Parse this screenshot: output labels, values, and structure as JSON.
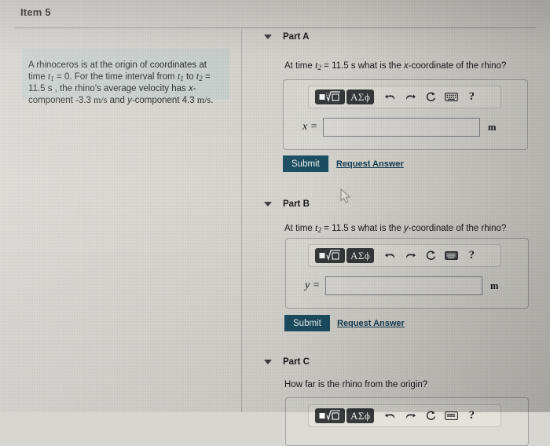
{
  "header": {
    "item_title": "Item 5"
  },
  "problem": {
    "line1_a": "A rhinoceros is at the origin of coordinates at time ",
    "t1": "t",
    "t1_sub": "1",
    "line2_a": " = 0. For the time interval from ",
    "t1b": "t",
    "t1b_sub": "1",
    "line2_b": " to ",
    "t2": "t",
    "t2_sub": "2",
    "line2_c": " = 11.5 s , the rhino's average velocity has ",
    "xvar": "x",
    "line3_a": "-component -3.3 ",
    "unit_ms": "m/s",
    "line3_b": " and ",
    "yvar": "y",
    "line3_c": "-component 4.3 ",
    "unit_ms2": "m/s",
    "period": "."
  },
  "toolbar": {
    "template_button": "template-button",
    "greek_button": "ΑΣϕ",
    "undo": "undo-arrow",
    "redo": "redo-arrow",
    "reset": "reset-circular-arrow",
    "keyboard": "keyboard-icon",
    "help": "?"
  },
  "parts": [
    {
      "id": "part-a",
      "label": "Part A",
      "question_pre": "At time ",
      "question_var": "t",
      "question_sub": "2",
      "question_mid": " = 11.5 s what is the ",
      "question_coord": "x",
      "question_post": "-coordinate of the rhino?",
      "var_label": "x =",
      "input_value": "",
      "input_placeholder": "",
      "unit": "m",
      "submit_label": "Submit",
      "request_label": "Request Answer"
    },
    {
      "id": "part-b",
      "label": "Part B",
      "question_pre": "At time ",
      "question_var": "t",
      "question_sub": "2",
      "question_mid": " = 11.5 s what is the ",
      "question_coord": "y",
      "question_post": "-coordinate of the rhino?",
      "var_label": "y =",
      "input_value": "",
      "input_placeholder": "",
      "unit": "m",
      "submit_label": "Submit",
      "request_label": "Request Answer"
    },
    {
      "id": "part-c",
      "label": "Part C",
      "question_full": "How far is the rhino from the origin?"
    }
  ],
  "colors": {
    "submit_background": "#1c4f63",
    "link": "#123c55",
    "problem_box": "#c4d0cf",
    "toolbar_button": "#37393b",
    "page_background": "#d9d7d1"
  },
  "cursor": {
    "name": "mouse-pointer"
  }
}
